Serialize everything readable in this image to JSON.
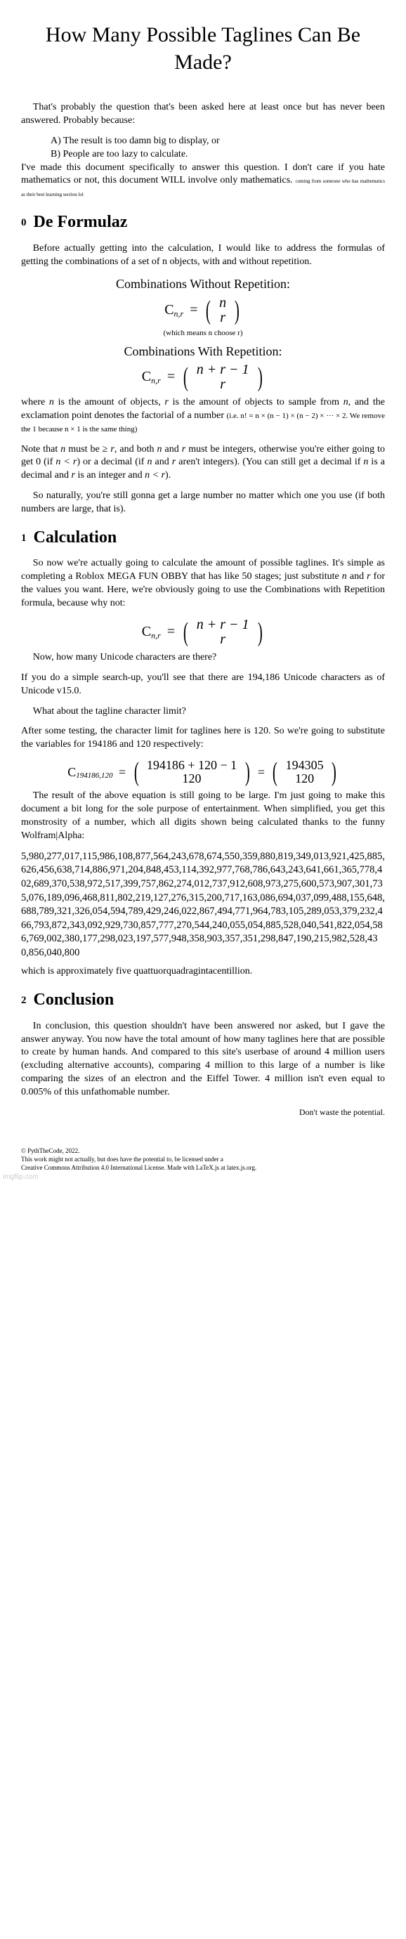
{
  "title": "How Many Possible Taglines Can Be Made?",
  "intro": {
    "lead": "That's probably the question that's been asked here at least once but has never been answered. Probably because:",
    "optA": "A) The result is too damn big to display, or",
    "optB": "B) People are too lazy to calculate.",
    "tail1": "I've made this document specifically to answer this question. I don't care if you hate mathematics or not, this document WILL involve only mathematics. ",
    "tailTiny": "coming from someone who has mathematics as their best learning section lol"
  },
  "sec0": {
    "num": "0",
    "title": "De Formulaz"
  },
  "p0a": "Before actually getting into the calculation, I would like to address the formulas of getting the combinations of a set of n objects, with and without repetition.",
  "combNoRepHead": "Combinations Without Repetition:",
  "fnr": {
    "C": "C",
    "sub": "n,r",
    "eq": "=",
    "top": "n",
    "bot": "r"
  },
  "nChooseR": "(which means n choose r)",
  "combRepHead": "Combinations With Repetition:",
  "frep": {
    "C": "C",
    "sub": "n,r",
    "eq": "=",
    "top": "n + r − 1",
    "bot": "r"
  },
  "p0b": {
    "a": "where ",
    "n": "n",
    "b": " is the amount of objects, ",
    "r": "r",
    "c": " is the amount of objects to sample from ",
    "n2": "n",
    "d": ", and the exclamation point denotes the factorial of a number ",
    "inline": "(i.e. n! = n × (n − 1) × (n − 2) × ··· × 2. We remove the 1 because n × 1 is the same thing)"
  },
  "p0c": {
    "a": "Note that ",
    "n": "n",
    "b": " must be  ≥ ",
    "r": "r",
    "c": ", and both ",
    "n2": "n",
    "d": " and ",
    "r2": "r",
    "e": " must be integers, otherwise you're either going to get 0 (if ",
    "cond1": "n < r",
    "f": ") or a decimal (if ",
    "n3": "n",
    "g": " and ",
    "r3": "r",
    "h": " aren't integers). (You can still get a decimal if ",
    "n4": "n",
    "i": " is a decimal and ",
    "r4": "r",
    "j": " is an integer and ",
    "cond2": "n < r",
    "k": ")."
  },
  "p0d": "So naturally, you're still gonna get a large number no matter which one you use (if both numbers are large, that is).",
  "sec1": {
    "num": "1",
    "title": "Calculation"
  },
  "p1a": {
    "a": "So now we're actually going to calculate the amount of possible taglines. It's simple as completing a Roblox MEGA FUN OBBY that has like 50 stages; just substitute ",
    "n": "n",
    "b": " and ",
    "r": "r",
    "c": " for the values you want. Here, we're obviously going to use the Combinations with Repetition formula, because why not:"
  },
  "p1b": "Now, how many Unicode characters are there?",
  "p1c": "If you do a simple search-up, you'll see that there are 194,186 Unicode characters as of Unicode v15.0.",
  "p1d": "What about the tagline character limit?",
  "p1e": "After some testing, the character limit for taglines here is 120. So we're going to substitute the variables for 194186 and 120 respectively:",
  "bigFormula": {
    "C": "C",
    "sub": "194186,120",
    "eq1": "=",
    "top1": "194186 + 120 − 1",
    "bot1": "120",
    "eq2": "=",
    "top2": "194305",
    "bot2": "120"
  },
  "p1f": "The result of the above equation is still going to be large. I'm just going to make this document a bit long for the sole purpose of entertainment. When simplified, you get this monstrosity of a number, which all digits shown being calculated thanks to the funny Wolfram|Alpha:",
  "number": "5,980,277,017,115,986,108,877,564,243,678,674,550,359,880,819,349,013,921,425,885,626,456,638,714,886,971,204,848,453,114,392,977,768,786,643,243,641,661,365,778,402,689,370,538,972,517,399,757,862,274,012,737,912,608,973,275,600,573,907,301,735,076,189,096,468,811,802,219,127,276,315,200,717,163,086,694,037,099,488,155,648,688,789,321,326,054,594,789,429,246,022,867,494,771,964,783,105,289,053,379,232,466,793,872,343,092,929,730,857,777,270,544,240,055,054,885,528,040,541,822,054,586,769,002,380,177,298,023,197,577,948,358,903,357,351,298,847,190,215,982,528,430,856,040,800",
  "p1g": "which is approximately five quattuorquadragintacentillion.",
  "sec2": {
    "num": "2",
    "title": "Conclusion"
  },
  "p2a": "In conclusion, this question shouldn't have been answered nor asked, but I gave the answer anyway. You now have the total amount of how many taglines here that are possible to create by human hands. And compared to this site's userbase of around 4 million users (excluding alternative accounts), comparing 4 million to this large of a number is like comparing the sizes of an electron and the Eiffel Tower. 4 million isn't even equal to 0.005% of this unfathomable number.",
  "p2b": "Don't waste the potential.",
  "footer": {
    "l1": "© PythTheCode, 2022.",
    "l2": "This work might not actually, but does have the potential to, be licensed under a",
    "l3": "Creative Commons Attribution 4.0 International License. Made with LaTeX.js at latex.js.org."
  },
  "watermark": "imgflip.com"
}
